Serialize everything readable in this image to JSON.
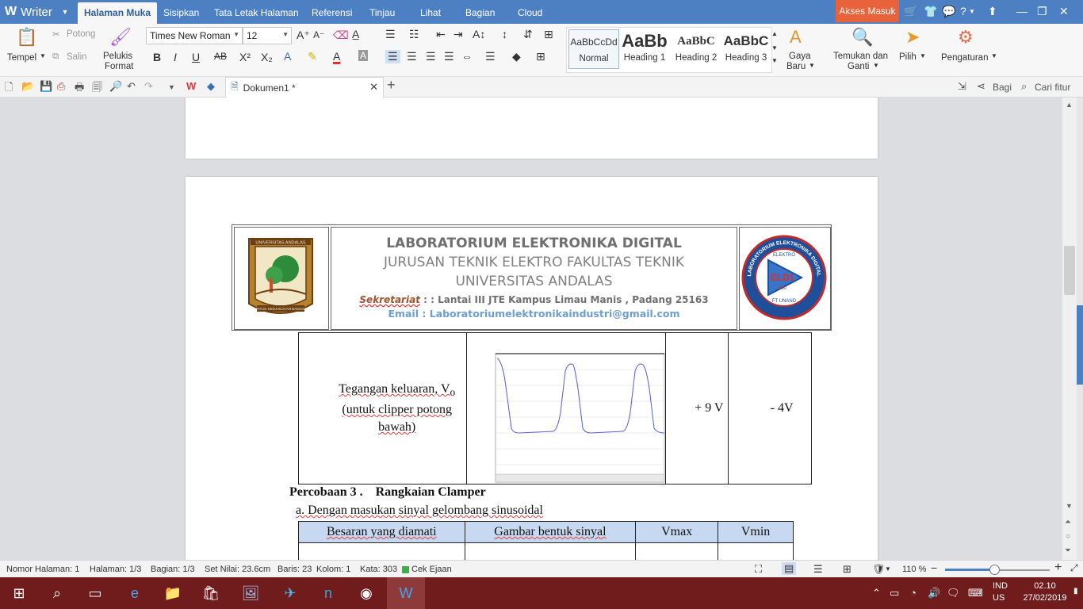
{
  "app": {
    "name": "Writer"
  },
  "menu": {
    "tabs": [
      "Halaman Muka",
      "Sisipkan",
      "Tata Letak Halaman",
      "Referensi",
      "Tinjau",
      "Lihat",
      "Bagian",
      "Cloud"
    ],
    "active": "Halaman Muka",
    "login": "Akses Masuk",
    "help": "?"
  },
  "ribbon": {
    "paste": "Tempel",
    "cut": "Potong",
    "copy": "Salin",
    "format_painter_1": "Pelukis",
    "format_painter_2": "Format",
    "font_name": "Times New Roman",
    "font_size": "12",
    "styles": [
      {
        "sample": "AaBbCcDd",
        "label": "Normal"
      },
      {
        "sample": "AaBb",
        "label": "Heading 1"
      },
      {
        "sample": "AaBbC",
        "label": "Heading 2"
      },
      {
        "sample": "AaBbC",
        "label": "Heading 3"
      }
    ],
    "new_style_1": "Gaya",
    "new_style_2": "Baru",
    "find_replace_1": "Temukan dan",
    "find_replace_2": "Ganti",
    "select": "Pilih",
    "settings": "Pengaturan"
  },
  "quickbar": {
    "doc_tab": "Dokumen1 *",
    "share": "Bagi",
    "search": "Cari fitur"
  },
  "document": {
    "header": {
      "line1": "LABORATORIUM ELEKTRONIKA DIGITAL",
      "line2": "JURUSAN TEKNIK ELEKTRO FAKULTAS TEKNIK",
      "line3": "UNIVERSITAS ANDALAS",
      "line4_prefix": "Sekretariat",
      "line4_rest": " : : Lantai III JTE Kampus Limau Manis , Padang 25163",
      "line5": "Email : Laboratoriumelektronikaindustri@gmail.com",
      "logo_left_text": "UNIVERSITAS ANDALAS",
      "logo_left_motto": "UNTUK KEDJADJAAN BANGSA",
      "logo_right_ring": "LABORATORIUM ELEKTRONIKA DIGITAL",
      "logo_right_inner": "ELEKTRO",
      "logo_right_code": "ELD1",
      "logo_right_year": "2002",
      "logo_right_bottom": "FT UNAND"
    },
    "table1_row": {
      "label_line1": "Tegangan keluaran, V",
      "label_sub": "o",
      "label_line2": "(untuk clipper potong",
      "label_line3": "bawah)",
      "vmax": "+ 9 V",
      "vmin": "- 4V"
    },
    "section_title": "Percobaan 3 .    Rangkaian Clamper",
    "section_sub": "a. Dengan masukan sinyal gelombang sinusoidal",
    "table2_headers": [
      "Besaran yang diamati",
      "Gambar bentuk sinyal",
      "Vmax",
      "Vmin"
    ]
  },
  "statusbar": {
    "page_no": "Nomor Halaman: 1",
    "page": "Halaman: 1/3",
    "section": "Bagian: 1/3",
    "set_value": "Set Nilai: 23.6cm",
    "row": "Baris: 23",
    "col": "Kolom: 1",
    "words": "Kata: 303",
    "spell": "Cek Ejaan",
    "zoom": "110 %",
    "zoom_level": 0.47
  },
  "taskbar": {
    "lang1": "IND",
    "lang2": "US",
    "time": "02.10",
    "date": "27/02/2019"
  },
  "colors": {
    "menubar": "#4d80c3",
    "login": "#e8623b",
    "taskbar": "#701c1c",
    "table_header": "#c6d9f1",
    "waveform": "#5b5bd6"
  }
}
